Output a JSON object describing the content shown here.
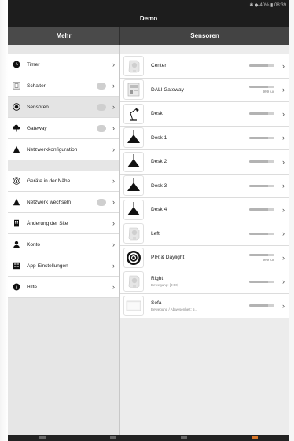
{
  "status": {
    "text": "✱ ◆ 40% ▮ 08:39"
  },
  "app": {
    "title": "Demo"
  },
  "left_header": "Mehr",
  "right_header": "Sensoren",
  "menu": [
    {
      "label": "Timer",
      "icon": "clock-icon",
      "badge": false
    },
    {
      "label": "Schalter",
      "icon": "switch-icon",
      "badge": true
    },
    {
      "label": "Sensoren",
      "icon": "sensor-icon",
      "badge": true,
      "selected": true
    },
    {
      "label": "Gateway",
      "icon": "cloud-gateway-icon",
      "badge": true
    },
    {
      "label": "Netzwerkkonfiguration",
      "icon": "network-triangle-icon",
      "badge": false
    }
  ],
  "menu2": [
    {
      "label": "Geräte in der Nähe",
      "icon": "nearby-signal-icon",
      "badge": false
    },
    {
      "label": "Netzwerk wechseln",
      "icon": "network-triangle-icon",
      "badge": true
    },
    {
      "label": "Änderung der Site",
      "icon": "building-icon",
      "badge": false
    },
    {
      "label": "Konto",
      "icon": "person-icon",
      "badge": false
    },
    {
      "label": "App-Einstellungen",
      "icon": "settings-grid-icon",
      "badge": false
    },
    {
      "label": "Hilfe",
      "icon": "info-icon",
      "badge": false
    }
  ],
  "sensors": [
    {
      "name": "Center",
      "sub": "",
      "level": 0.75,
      "lux": "",
      "icon": "sensor-device-icon"
    },
    {
      "name": "DALI Gateway",
      "sub": "",
      "level": 0.75,
      "lux": "999 lux",
      "icon": "gateway-device-icon"
    },
    {
      "name": "Desk",
      "sub": "",
      "level": 0.75,
      "lux": "",
      "icon": "desk-lamp-icon"
    },
    {
      "name": "Desk 1",
      "sub": "",
      "level": 0.75,
      "lux": "",
      "icon": "pendant-lamp-icon"
    },
    {
      "name": "Desk 2",
      "sub": "",
      "level": 0.75,
      "lux": "",
      "icon": "pendant-lamp-icon"
    },
    {
      "name": "Desk 3",
      "sub": "",
      "level": 0.75,
      "lux": "",
      "icon": "pendant-lamp-icon"
    },
    {
      "name": "Desk 4",
      "sub": "",
      "level": 0.75,
      "lux": "",
      "icon": "pendant-lamp-icon"
    },
    {
      "name": "Left",
      "sub": "",
      "level": 0.75,
      "lux": "",
      "icon": "sensor-device-icon"
    },
    {
      "name": "PIR & Daylight",
      "sub": "",
      "level": 0.75,
      "lux": "999 lux",
      "icon": "pir-target-icon"
    },
    {
      "name": "Right",
      "sub": "Bewegung: [0:00]",
      "level": 0.75,
      "lux": "",
      "icon": "sensor-device-icon"
    },
    {
      "name": "Sofa",
      "sub": "Bewegung / Abwesenheit: 5...",
      "level": 0.75,
      "lux": "",
      "icon": "sofa-panel-icon"
    }
  ],
  "chevron": "›",
  "colors": {
    "dark": "#1d1d1d",
    "header_left": "#4a4a4a",
    "header_right": "#434343"
  }
}
